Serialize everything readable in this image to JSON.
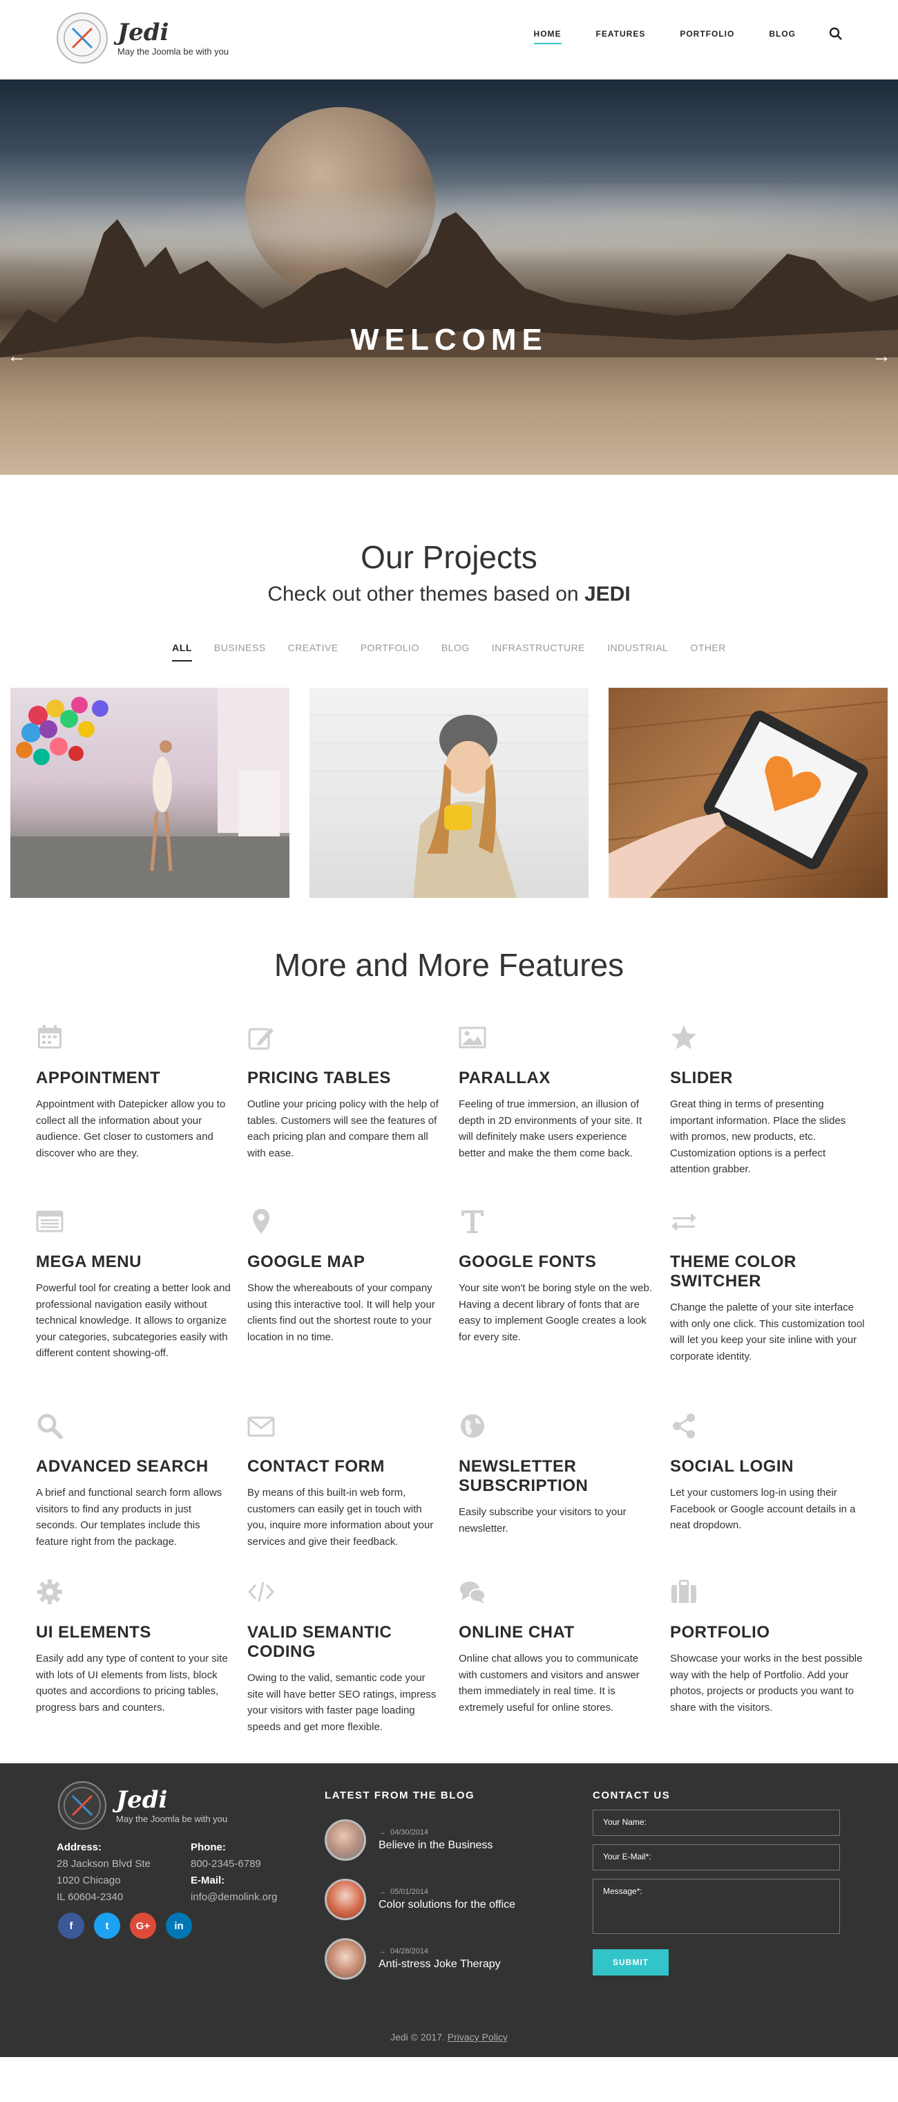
{
  "header": {
    "logo_name": "Jedi",
    "logo_tagline": "May the Joomla be with you",
    "nav": [
      {
        "label": "HOME",
        "active": true
      },
      {
        "label": "FEATURES",
        "active": false
      },
      {
        "label": "PORTFOLIO",
        "active": false
      },
      {
        "label": "BLOG",
        "active": false
      }
    ]
  },
  "hero": {
    "title": "WELCOME",
    "prev_arrow": "←",
    "next_arrow": "→"
  },
  "projects": {
    "title": "Our Projects",
    "subtitle_prefix": "Check out other themes based on",
    "subtitle_brand": "JEDI",
    "filters": [
      "ALL",
      "BUSINESS",
      "CREATIVE",
      "PORTFOLIO",
      "BLOG",
      "INFRASTRUCTURE",
      "INDUSTRIAL",
      "OTHER"
    ],
    "active_filter": "ALL"
  },
  "features": {
    "title": "More and More Features",
    "items": [
      {
        "icon": "calendar-icon",
        "title": "APPOINTMENT",
        "text": "Appointment with Datepicker allow you to collect all the information about your audience. Get closer to customers and discover who are they."
      },
      {
        "icon": "edit-icon",
        "title": "PRICING TABLES",
        "text": "Outline your pricing policy with the help of tables. Customers will see the features of each pricing plan and compare them all with ease."
      },
      {
        "icon": "image-icon",
        "title": "PARALLAX",
        "text": "Feeling of true immersion, an illusion of depth in 2D environments of your site. It will definitely make users experience better and make the them come back."
      },
      {
        "icon": "star-icon",
        "title": "SLIDER",
        "text": "Great thing in terms of presenting important information. Place the slides with promos, new products, etc. Customization options is a perfect attention grabber."
      },
      {
        "icon": "menu-icon",
        "title": "MEGA MENU",
        "text": "Powerful tool for creating a better look and professional navigation easily without technical knowledge. It allows to organize your categories, subcategories easily with different content showing-off."
      },
      {
        "icon": "map-marker-icon",
        "title": "GOOGLE MAP",
        "text": "Show the whereabouts of your company using this interactive tool. It will help your clients find out the shortest route to your location in no time."
      },
      {
        "icon": "font-icon",
        "title": "GOOGLE FONTS",
        "text": "Your site won't be boring style on the web. Having a decent library of fonts that are easy to implement Google creates a look for every site."
      },
      {
        "icon": "exchange-icon",
        "title": "THEME COLOR SWITCHER",
        "text": "Change the palette of your site interface with only one click. This customization tool will let you keep your site inline with your corporate identity."
      },
      {
        "icon": "search-icon",
        "title": "ADVANCED SEARCH",
        "text": "A brief and functional search form allows visitors to find any products in just seconds. Our templates include this feature right from the package."
      },
      {
        "icon": "envelope-icon",
        "title": "CONTACT FORM",
        "text": "By means of this built-in web form, customers can easily get in touch with you, inquire more information about your services and give their feedback."
      },
      {
        "icon": "globe-icon",
        "title": "NEWSLETTER SUBSCRIPTION",
        "text": "Easily subscribe your visitors to your newsletter."
      },
      {
        "icon": "share-icon",
        "title": "SOCIAL LOGIN",
        "text": "Let your customers log-in using their Facebook or Google account details in a neat dropdown."
      },
      {
        "icon": "gear-icon",
        "title": "UI ELEMENTS",
        "text": "Easily add any type of content to your site with lots of UI elements from lists, block quotes and accordions to pricing tables, progress bars and counters."
      },
      {
        "icon": "code-icon",
        "title": "VALID SEMANTIC CODING",
        "text": "Owing to the valid, semantic code your site will have better SEO ratings, impress your visitors with faster page loading speeds and get more flexible."
      },
      {
        "icon": "chat-icon",
        "title": "ONLINE CHAT",
        "text": "Online chat allows you to communicate with customers and visitors and answer them immediately in real time. It is extremely useful for online stores."
      },
      {
        "icon": "briefcase-icon",
        "title": "PORTFOLIO",
        "text": "Showcase your works in the best possible way with the help of Portfolio. Add your photos, projects or products you want to share with the visitors."
      }
    ]
  },
  "footer": {
    "logo_name": "Jedi",
    "logo_tagline": "May the Joomla be with you",
    "address_label": "Address:",
    "address_lines": [
      "28 Jackson Blvd Ste",
      "1020 Chicago",
      "IL 60604-2340"
    ],
    "phone_label": "Phone:",
    "phone": "800-2345-6789",
    "email_label": "E-Mail:",
    "email": "info@demolink.org",
    "socials": [
      {
        "icon": "facebook-icon",
        "glyph": "f",
        "color": "#3b5998"
      },
      {
        "icon": "twitter-icon",
        "glyph": "t",
        "color": "#1da1f2"
      },
      {
        "icon": "google-plus-icon",
        "glyph": "G+",
        "color": "#dd4b39"
      },
      {
        "icon": "linkedin-icon",
        "glyph": "in",
        "color": "#0077b5"
      }
    ],
    "blog_heading": "LATEST FROM THE BLOG",
    "posts": [
      {
        "date": "04/30/2014",
        "title": "Believe in the Business"
      },
      {
        "date": "05/01/2014",
        "title": "Color solutions for the office"
      },
      {
        "date": "04/28/2014",
        "title": "Anti-stress Joke Therapy"
      }
    ],
    "contact_heading": "CONTACT US",
    "form": {
      "name_placeholder": "Your Name:",
      "email_placeholder": "Your E-Mail*:",
      "message_placeholder": "Message*:",
      "submit_label": "SUBMIT"
    },
    "copyright": "Jedi © 2017.",
    "privacy_label": "Privacy Policy"
  }
}
